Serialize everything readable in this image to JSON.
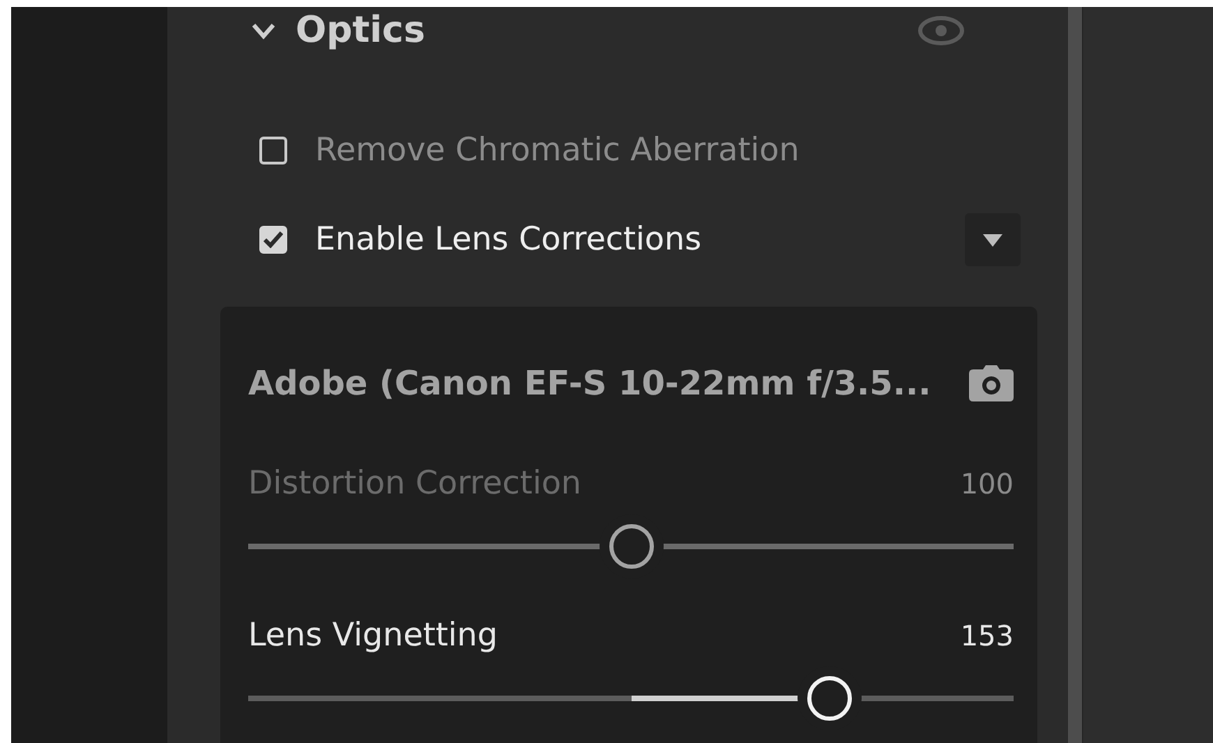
{
  "section": {
    "title": "Optics",
    "expanded": true
  },
  "options": [
    {
      "label": "Remove Chromatic Aberration",
      "checked": false,
      "menu": false
    },
    {
      "label": "Enable Lens Corrections",
      "checked": true,
      "menu": true
    }
  ],
  "profile": {
    "title": "Adobe (Canon EF-S 10-22mm f/3.5..."
  },
  "sliders": [
    {
      "label": "Distortion Correction",
      "value": "100",
      "level": 0.5,
      "disabled": true
    },
    {
      "label": "Lens Vignetting",
      "value": "153",
      "level": 0.76,
      "disabled": false
    }
  ]
}
